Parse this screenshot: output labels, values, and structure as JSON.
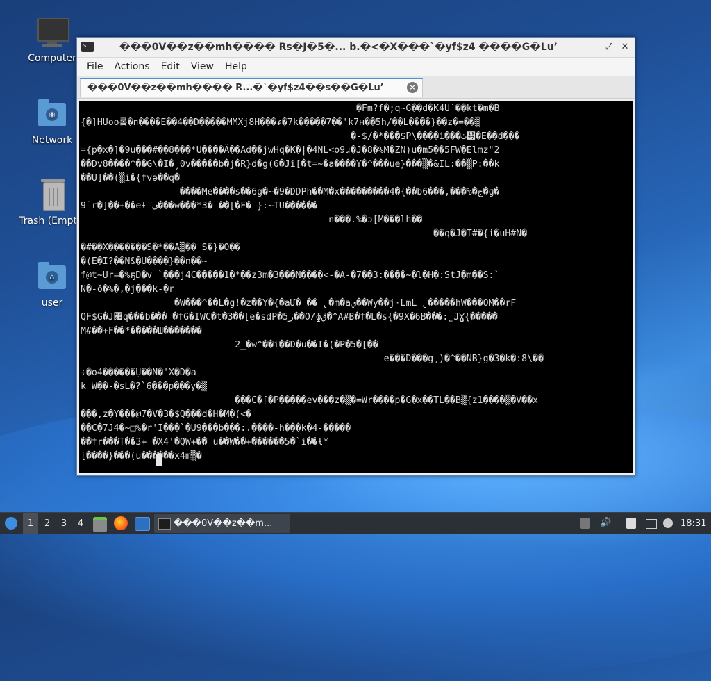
{
  "desktop": {
    "icons": [
      {
        "label": "Computer"
      },
      {
        "label": "Network"
      },
      {
        "label": "Trash (Empty)"
      },
      {
        "label": "user"
      }
    ]
  },
  "window": {
    "title": "���0V��z��mh���� Rs�J�5�... b.�<�X���`�yf$z4 ����G�Lu’",
    "controls": {
      "minimize": "–",
      "maximize": "⤢",
      "close": "✕"
    },
    "menu": [
      "File",
      "Actions",
      "Edit",
      "View",
      "Help"
    ],
    "tab": {
      "title": "���0V��z��mh���� R...�`�yf$z4��s��G�Lu’",
      "close": "×"
    }
  },
  "terminal": {
    "lines": [
      "                                                  �Fm?f�;q~G��d�K4U˙��kt�m�B",
      "{�]HUoo롴�ᴨ����E��4��D�����MMXj8H���ᵳ�7k�����7��'k7ʜ��5h/��L����}��z�=��▒",
      "                                                 �-$/�*���$P\\����i���ٺ᥷�E��d���",
      "={p�x�]�9u���#��8���*U����Ä��Ad��jwHq�K�|�4NL<o9ɹ�J�8�%M�ZN)u�m5��5FW�Elmz\"2",
      "��Dv8����^��G\\�I�ˏ0v�����b�j�R}d�g(6�Ji[�t=~�a����Y�^���ue}���▒�&IL:��▒P:��k",
      "��U]��(▒i�{fvə��q�",
      "                  ����Me����s��6g�~�9�DDPh��M�x���������4�{��b6���,���%�ج�ɡ�",
      "9˙r�]��+��eƚ-ى���w���*3� ��[�F� }:~TU������",
      "                                             n���.%�ɔ[M���lh��",
      "                                                                ��q�J�T#�{i�uH#N�",
      "�#��X�������S�*��A▒�� S�}�O��",
      "�(E�I?��N&�U����}��n��~",
      "f@t~Ur=�%ҕD�v `���j4C�����1�*��z3m�3���N����<-�A-�7��3:����~�l�H�:StJ�m��S:`",
      "N�-ŏ�%�,�j���k-�r",
      "                 �W���^��L�g!�z��Y�{�aՄ� �� ̢�m�aي��Wy��j·LmL ̢�����hW���OM��rF",
      "QF$G�J꭯q���b��� �fG�IWC�t�3��[e�sdP�5ر��O/ɸق�^A#B�f�L�s{�9X�6B���:˾JƔ{�����",
      "M#��+F��*�����Ш�������",
      "                            2_�w^��i��D�u��I�(�P�5�[��",
      "                                                       e���D���g¸)�^��NB}g�3�k�:8\\��",
      "÷�o4������Ụ��N�'X�D�a",
      "k W��-�sᒪ�?`6���p���y�▒",
      "                            ���C�[�P�����ev���z�▒�=Wr����p�G�x��TL��B▒{z1����▒�V��x",
      "���,z�Y���@7�V�3�$Q���d�H�M�(<�",
      "��C�7J4�~□%�r'I���`�U9���b���:.����-h���k�4-�����",
      "��fr���T��3+ �X4'�QW+�� u��W��+������5�`i��ƚ*",
      "[����}���(u������x4m▒�"
    ]
  },
  "taskbar": {
    "workspaces": [
      "1",
      "2",
      "3",
      "4"
    ],
    "active_task": "���0V��z��m...",
    "clock": "18:31"
  }
}
